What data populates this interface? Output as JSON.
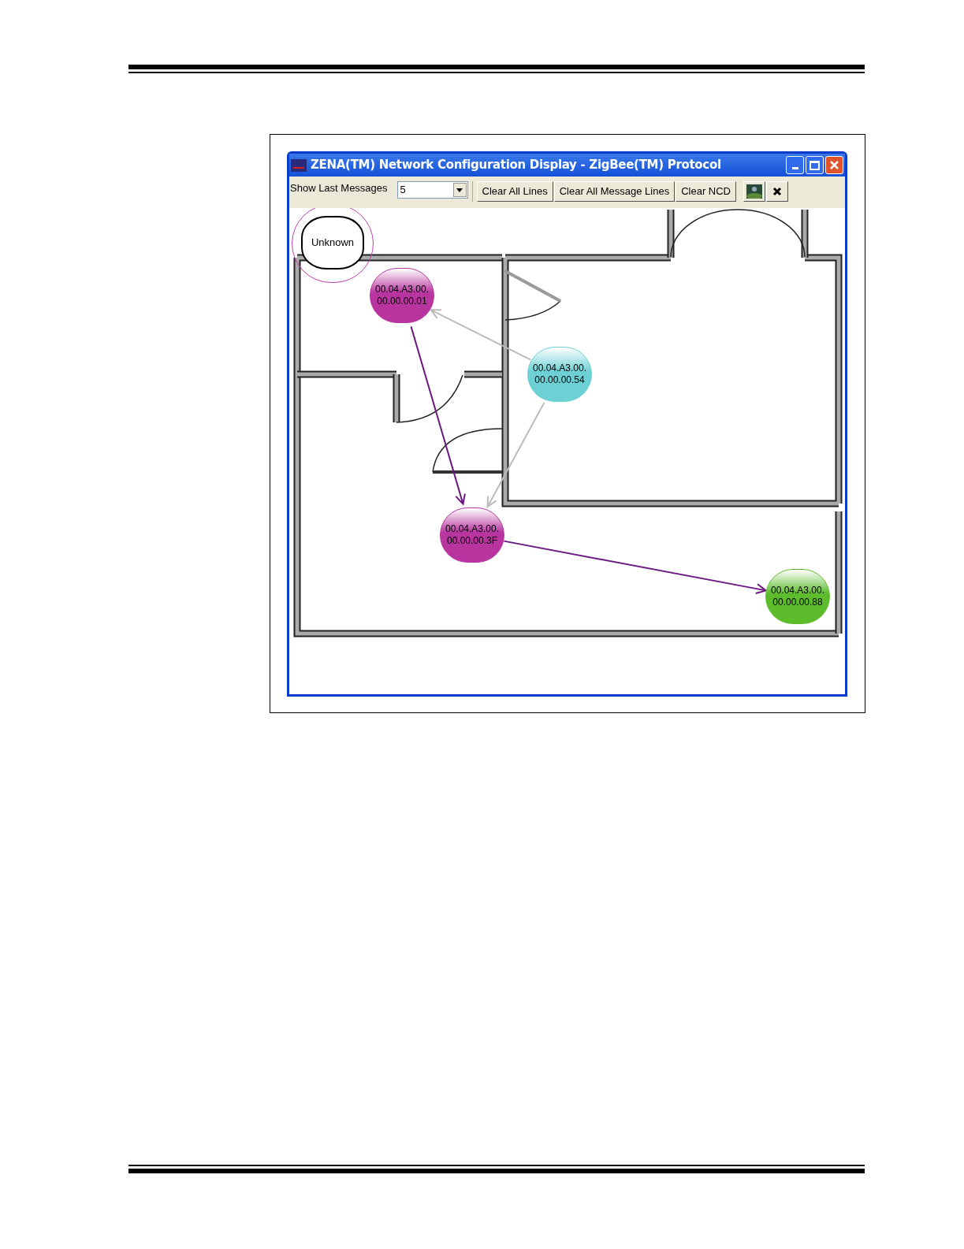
{
  "window": {
    "title": "ZENA(TM) Network Configuration Display - ZigBee(TM) Protocol"
  },
  "toolbar": {
    "show_last_label": "Show Last Messages",
    "show_last_value": "5",
    "buttons": [
      {
        "kind": "text",
        "label": "Clear All Lines"
      },
      {
        "kind": "text",
        "label": "Clear All Message Lines"
      },
      {
        "kind": "text",
        "label": "Clear NCD"
      },
      {
        "kind": "image"
      },
      {
        "kind": "close"
      }
    ]
  },
  "nodes": [
    {
      "kind": "unknown",
      "lines": [
        "Unknown"
      ],
      "color": "#c040b0"
    },
    {
      "kind": "device",
      "lines": [
        "00.04.A3.00.",
        "00.00.00.01"
      ],
      "color": "#b8359f"
    },
    {
      "kind": "device",
      "lines": [
        "00.04.A3.00.",
        "00.00.00.54"
      ],
      "color": "#6cd0d4"
    },
    {
      "kind": "device",
      "lines": [
        "00.04.A3.00.",
        "00.00.00.3F"
      ],
      "color": "#b8359f"
    },
    {
      "kind": "device",
      "lines": [
        "00.04.A3.00.",
        "00.00.00.88"
      ],
      "color": "#5cbc2c"
    }
  ],
  "links": [
    {
      "color": "#bcbcbc"
    },
    {
      "color": "#bcbcbc"
    },
    {
      "color": "#6a1a80"
    },
    {
      "color": "#6a1a80"
    }
  ]
}
